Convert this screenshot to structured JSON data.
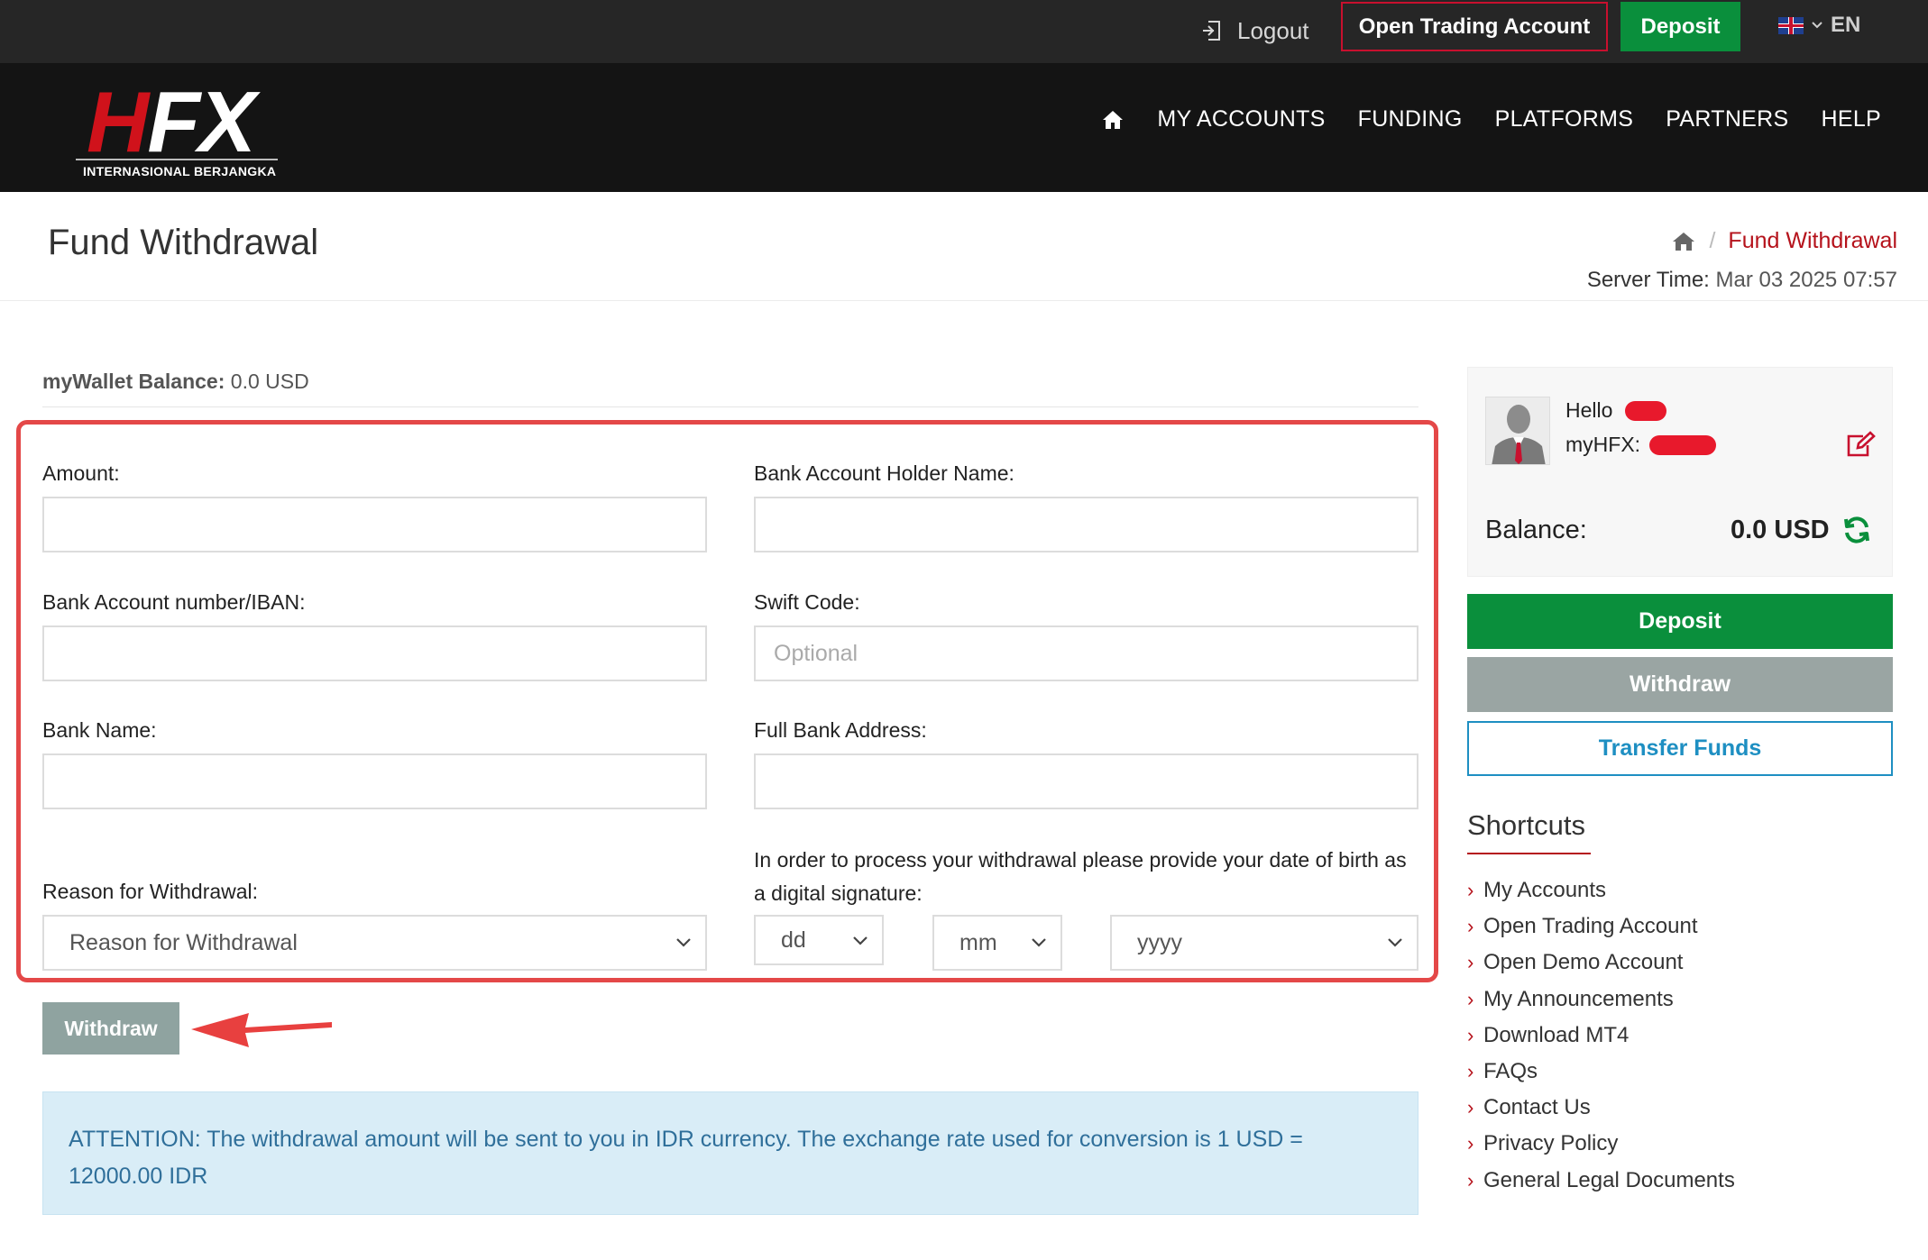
{
  "topbar": {
    "logout_label": "Logout",
    "open_trading_label": "Open Trading Account",
    "deposit_label": "Deposit",
    "language": "EN"
  },
  "header": {
    "logo_h": "H",
    "logo_fx": "FX",
    "logo_subtitle": "INTERNASIONAL BERJANGKA",
    "nav": [
      "MY ACCOUNTS",
      "FUNDING",
      "PLATFORMS",
      "PARTNERS",
      "HELP"
    ]
  },
  "page": {
    "title": "Fund Withdrawal",
    "breadcrumb_current": "Fund Withdrawal",
    "breadcrumb_sep": "/",
    "server_time_label": "Server Time:",
    "server_time_value": "Mar 03 2025 07:57"
  },
  "wallet": {
    "label": "myWallet Balance:",
    "value": "0.0 USD"
  },
  "form": {
    "amount_label": "Amount:",
    "amount_value": "",
    "holder_label": "Bank Account Holder Name:",
    "holder_value": "",
    "iban_label": "Bank Account number/IBAN:",
    "iban_value": "",
    "swift_label": "Swift Code:",
    "swift_placeholder": "Optional",
    "bank_name_label": "Bank Name:",
    "bank_name_value": "",
    "bank_address_label": "Full Bank Address:",
    "bank_address_value": "",
    "reason_label": "Reason for Withdrawal:",
    "reason_selected": "Reason for Withdrawal",
    "dob_text": "In order to process your withdrawal please provide your date of birth as a digital signature:",
    "dob_day": "dd",
    "dob_month": "mm",
    "dob_year": "yyyy",
    "submit_label": "Withdraw"
  },
  "attention": {
    "text": "ATTENTION: The withdrawal amount will be sent to you in IDR currency. The exchange rate used for conversion is 1 USD = 12000.00 IDR"
  },
  "sidebar": {
    "hello_label": "Hello",
    "myhfx_label": "myHFX:",
    "balance_label": "Balance:",
    "balance_value": "0.0 USD",
    "deposit_label": "Deposit",
    "withdraw_label": "Withdraw",
    "transfer_label": "Transfer Funds",
    "shortcuts_title": "Shortcuts",
    "shortcuts": [
      "My Accounts",
      "Open Trading Account",
      "Open Demo Account",
      "My Announcements",
      "Download MT4",
      "FAQs",
      "Contact Us",
      "Privacy Policy",
      "General Legal Documents"
    ]
  },
  "colors": {
    "brand_red": "#d0121b",
    "deposit_green": "#0a8f3c",
    "withdraw_gray": "#9aa5a3",
    "transfer_blue": "#1e8fc2",
    "highlight_red": "#e44848",
    "attention_bg": "#d9edf7"
  },
  "icons": {
    "logout": "logout-icon",
    "home": "home-icon",
    "edit": "edit-icon",
    "refresh": "refresh-icon",
    "chevron": "chevron-down-icon",
    "shortcut": "chevron-right-icon",
    "flag": "uk-flag-icon"
  }
}
